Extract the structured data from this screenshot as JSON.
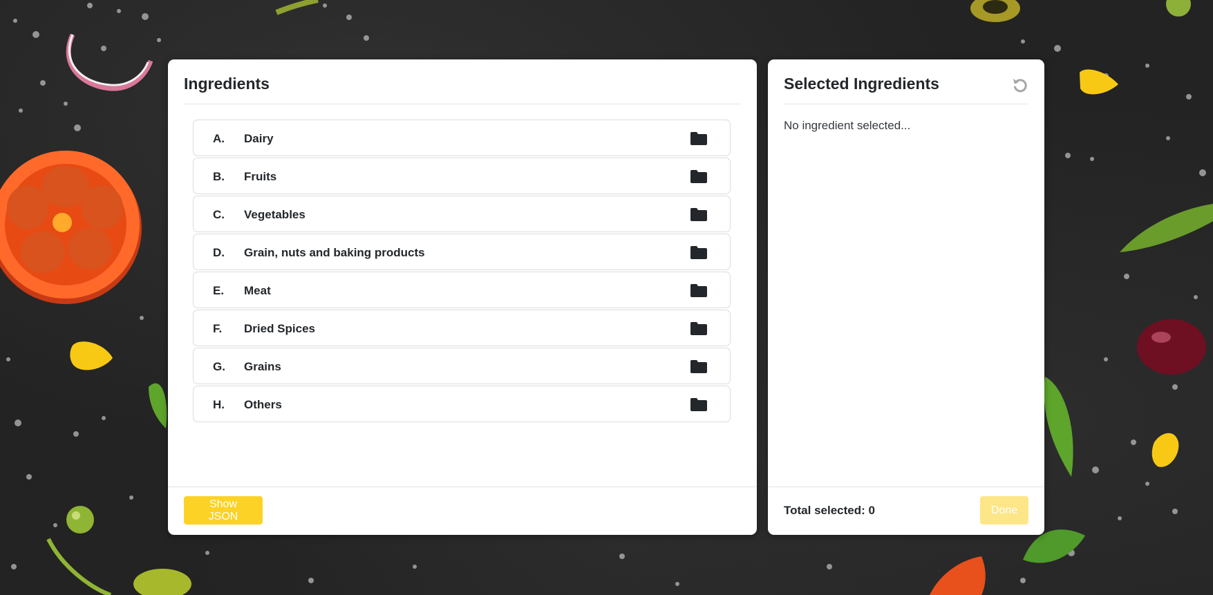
{
  "ingredients_panel": {
    "title": "Ingredients",
    "categories": [
      {
        "letter": "A.",
        "label": "Dairy"
      },
      {
        "letter": "B.",
        "label": "Fruits"
      },
      {
        "letter": "C.",
        "label": "Vegetables"
      },
      {
        "letter": "D.",
        "label": "Grain, nuts and baking products"
      },
      {
        "letter": "E.",
        "label": "Meat"
      },
      {
        "letter": "F.",
        "label": "Dried Spices"
      },
      {
        "letter": "G.",
        "label": "Grains"
      },
      {
        "letter": "H.",
        "label": "Others"
      }
    ],
    "show_json_label": "Show JSON"
  },
  "selected_panel": {
    "title": "Selected Ingredients",
    "empty_message": "No ingredient selected...",
    "total_label": "Total selected: 0",
    "done_label": "Done"
  },
  "icons": {
    "category": "folder-icon",
    "reset": "reset-icon"
  },
  "colors": {
    "accent": "#fcd227",
    "text": "#23272b",
    "background": "#232323"
  }
}
